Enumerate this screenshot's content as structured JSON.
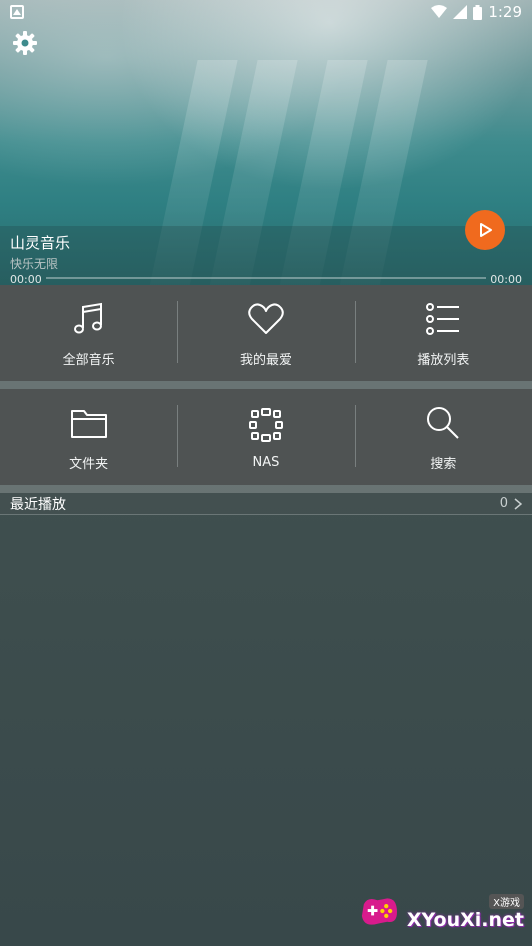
{
  "status_bar": {
    "time": "1:29"
  },
  "player": {
    "title": "山灵音乐",
    "artist": "快乐无限",
    "elapsed": "00:00",
    "duration": "00:00",
    "progress": 0,
    "accent_color": "#f06a1e"
  },
  "grid1": [
    {
      "label": "全部音乐",
      "icon": "music-note-icon"
    },
    {
      "label": "我的最爱",
      "icon": "heart-icon"
    },
    {
      "label": "播放列表",
      "icon": "playlist-icon"
    }
  ],
  "grid2": [
    {
      "label": "文件夹",
      "icon": "folder-icon"
    },
    {
      "label": "NAS",
      "icon": "nas-icon"
    },
    {
      "label": "搜索",
      "icon": "search-icon"
    }
  ],
  "recent": {
    "title": "最近播放",
    "count": "0"
  },
  "watermark": {
    "small": "X游戏",
    "main": "XYouXi.net"
  }
}
